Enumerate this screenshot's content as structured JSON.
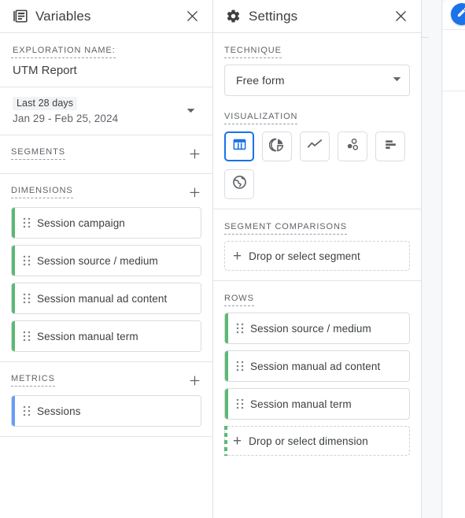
{
  "variables_panel": {
    "title": "Variables",
    "icon": "article-stack-icon",
    "close_icon": "close-icon",
    "exploration": {
      "label": "EXPLORATION NAME:",
      "value": "UTM Report"
    },
    "date_range": {
      "chip": "Last 28 days",
      "range": "Jan 29 - Feb 25, 2024",
      "caret_icon": "caret-down-icon"
    },
    "segments": {
      "label": "SEGMENTS",
      "add_icon": "plus-icon",
      "items": []
    },
    "dimensions": {
      "label": "DIMENSIONS",
      "add_icon": "plus-icon",
      "items": [
        {
          "label": "Session campaign"
        },
        {
          "label": "Session source / medium"
        },
        {
          "label": "Session manual ad content"
        },
        {
          "label": "Session manual term"
        }
      ]
    },
    "metrics": {
      "label": "METRICS",
      "add_icon": "plus-icon",
      "items": [
        {
          "label": "Sessions"
        }
      ]
    }
  },
  "settings_panel": {
    "title": "Settings",
    "icon": "gear-icon",
    "close_icon": "close-icon",
    "technique": {
      "label": "TECHNIQUE",
      "value": "Free form",
      "caret_icon": "caret-down-icon"
    },
    "visualization": {
      "label": "VISUALIZATION",
      "options": [
        {
          "name": "table-icon",
          "selected": true
        },
        {
          "name": "donut-chart-icon",
          "selected": false
        },
        {
          "name": "line-chart-icon",
          "selected": false
        },
        {
          "name": "scatter-plot-icon",
          "selected": false
        },
        {
          "name": "bar-chart-icon",
          "selected": false
        },
        {
          "name": "globe-icon",
          "selected": false
        }
      ]
    },
    "segment_comparisons": {
      "label": "SEGMENT COMPARISONS",
      "drop_text": "Drop or select segment"
    },
    "rows": {
      "label": "ROWS",
      "items": [
        {
          "label": "Session source / medium"
        },
        {
          "label": "Session manual ad content"
        },
        {
          "label": "Session manual term"
        }
      ],
      "drop_text": "Drop or select dimension"
    }
  },
  "edge_panel": {
    "fab_icon": "edit-pencil-icon"
  },
  "colors": {
    "accent": "#1a73e8",
    "dimension": "#5bb974",
    "metric": "#669df6",
    "text": "#3c4043",
    "muted": "#5f6368",
    "border": "#dadce0"
  }
}
